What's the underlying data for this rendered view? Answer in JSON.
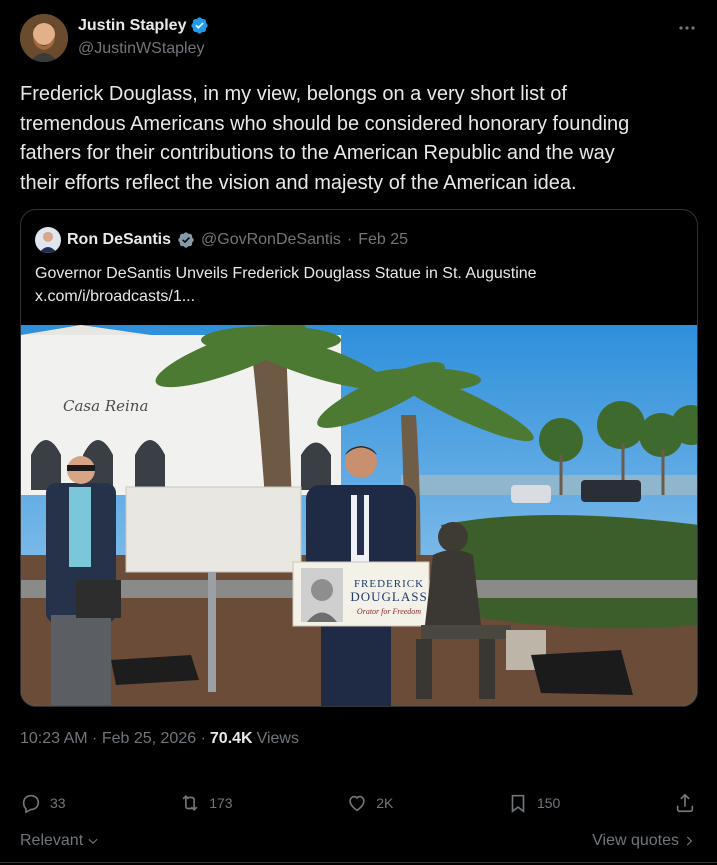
{
  "author": {
    "name": "Justin Stapley",
    "handle": "@JustinWStapley",
    "verified_color": "#1d9bf0"
  },
  "tweet": {
    "text": "Frederick Douglass, in my view, belongs on a very short list of\ntremendous Americans who should be considered honorary founding\nfathers for their contributions to the American Republic and the way\ntheir efforts reflect the vision and majesty of the American idea."
  },
  "quote": {
    "name": "Ron DeSantis",
    "handle": "@GovRonDeSantis",
    "separator": "·",
    "date": "Feb 25",
    "text": "Governor DeSantis Unveils Frederick Douglass Statue in St. Augustine x.com/i/broadcasts/1...",
    "media": {
      "building_sign": "Casa Reina",
      "podium_sign_line1": "FREDERICK",
      "podium_sign_line2": "DOUGLASS",
      "podium_sign_line3": "Orator for Freedom"
    }
  },
  "meta": {
    "time": "10:23 AM · Feb 25, 2026 ·",
    "views_count": "70.4K",
    "views_label": "Views"
  },
  "actions": {
    "replies": "33",
    "reposts": "173",
    "likes": "2K",
    "bookmarks": "150"
  },
  "footer": {
    "relevant": "Relevant",
    "view_quotes": "View quotes"
  },
  "colors": {
    "background": "#000000",
    "text_primary": "#e7e9ea",
    "text_secondary": "#71767b",
    "border": "#2f3336",
    "verified": "#1d9bf0"
  }
}
